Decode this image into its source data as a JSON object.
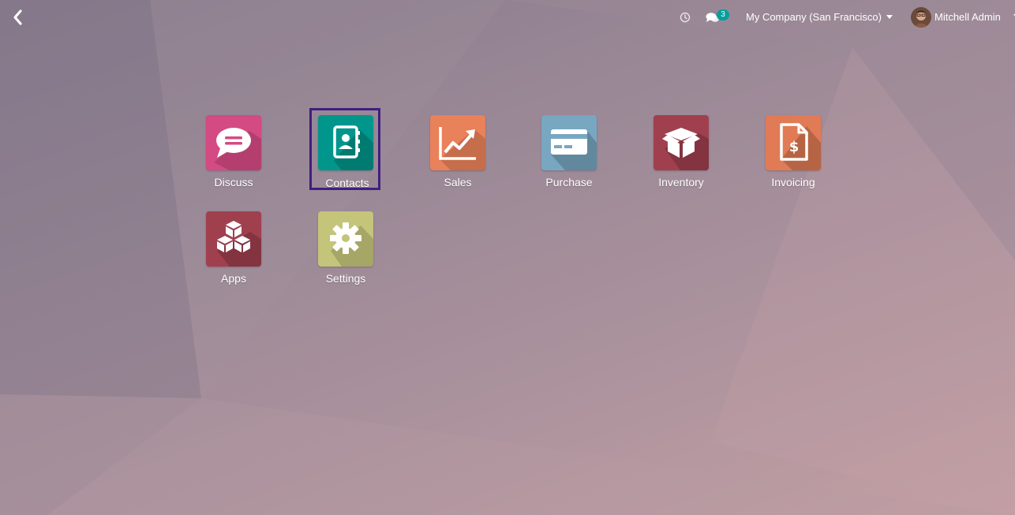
{
  "topbar": {
    "back_icon": "chevron-left-icon",
    "activity_icon": "clock-icon",
    "messages_icon": "comments-icon",
    "messages_count": "3",
    "company": "My Company (San Francisco)",
    "user_name": "Mitchell Admin"
  },
  "apps": [
    {
      "label": "Discuss",
      "icon": "chat-bubble-icon",
      "color": "#d44a83"
    },
    {
      "label": "Contacts",
      "icon": "address-book-icon",
      "color": "#00968c",
      "selected": true
    },
    {
      "label": "Sales",
      "icon": "trend-chart-icon",
      "color": "#e9815a"
    },
    {
      "label": "Purchase",
      "icon": "credit-card-icon",
      "color": "#78a7c1"
    },
    {
      "label": "Inventory",
      "icon": "open-box-icon",
      "color": "#a0404f"
    },
    {
      "label": "Invoicing",
      "icon": "invoice-dollar-icon",
      "color": "#e07b55"
    },
    {
      "label": "Apps",
      "icon": "cubes-icon",
      "color": "#a0404f"
    },
    {
      "label": "Settings",
      "icon": "gear-icon",
      "color": "#c4c47a"
    }
  ],
  "colors": {
    "selection_border": "#3f1f7f",
    "badge": "#00a09d"
  }
}
